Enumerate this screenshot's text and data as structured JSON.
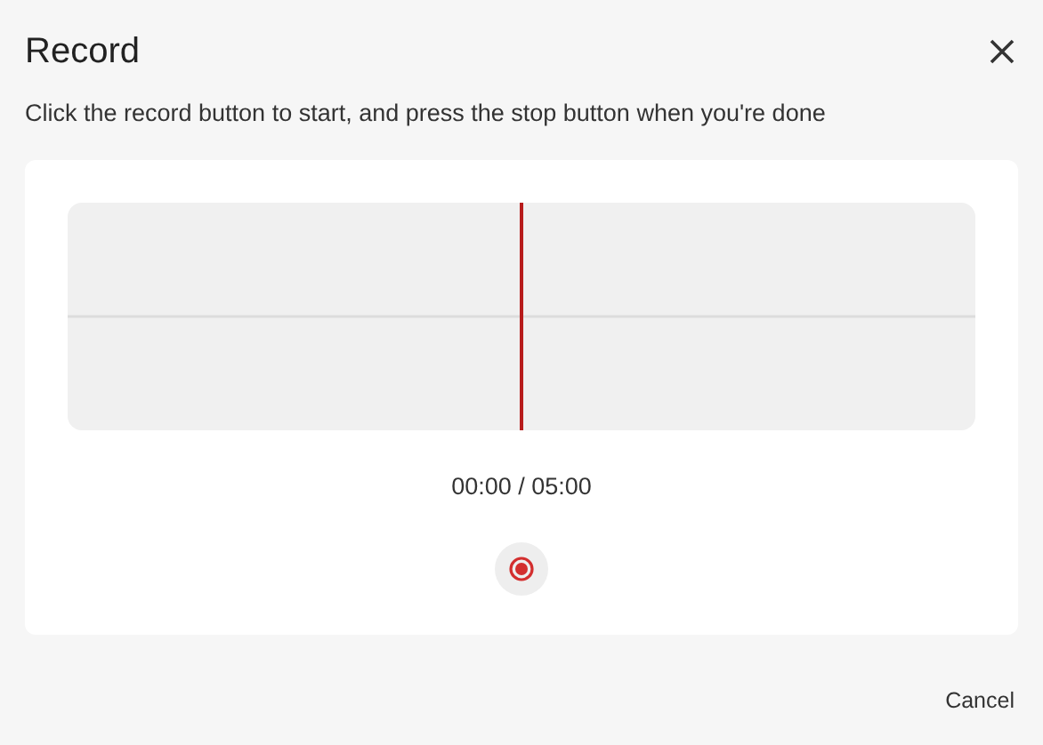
{
  "dialog": {
    "title": "Record",
    "instructions": "Click the record button to start, and press the stop button when you're done"
  },
  "recorder": {
    "time": "00:00 / 05:00",
    "recording": false
  },
  "buttons": [
    {
      "label": "Cancel"
    }
  ]
}
